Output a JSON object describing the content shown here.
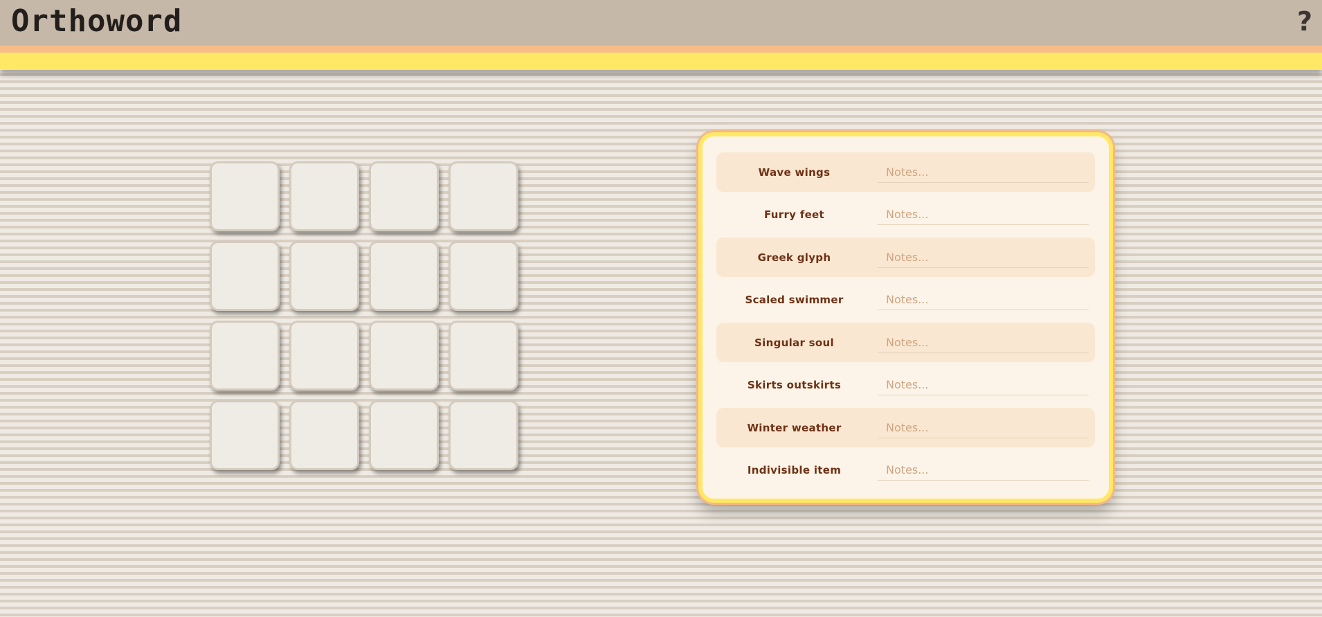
{
  "app": {
    "title": "Orthoword",
    "help_label": "?"
  },
  "board": {
    "tiles": [
      "",
      "",
      "",
      "",
      "",
      "",
      "",
      "",
      "",
      "",
      "",
      "",
      "",
      "",
      "",
      ""
    ]
  },
  "clues": [
    {
      "label": "Wave wings",
      "note_placeholder": "Notes...",
      "note_value": ""
    },
    {
      "label": "Furry feet",
      "note_placeholder": "Notes...",
      "note_value": ""
    },
    {
      "label": "Greek glyph",
      "note_placeholder": "Notes...",
      "note_value": ""
    },
    {
      "label": "Scaled swimmer",
      "note_placeholder": "Notes...",
      "note_value": ""
    },
    {
      "label": "Singular soul",
      "note_placeholder": "Notes...",
      "note_value": ""
    },
    {
      "label": "Skirts outskirts",
      "note_placeholder": "Notes...",
      "note_value": ""
    },
    {
      "label": "Winter weather",
      "note_placeholder": "Notes...",
      "note_value": ""
    },
    {
      "label": "Indivisible item",
      "note_placeholder": "Notes...",
      "note_value": ""
    }
  ],
  "colors": {
    "header_bg": "#c6b8a9",
    "accent_orange": "#f8bd87",
    "accent_yellow": "#ffe865",
    "clue_text": "#6e3115",
    "tile_bg": "#efece6"
  }
}
